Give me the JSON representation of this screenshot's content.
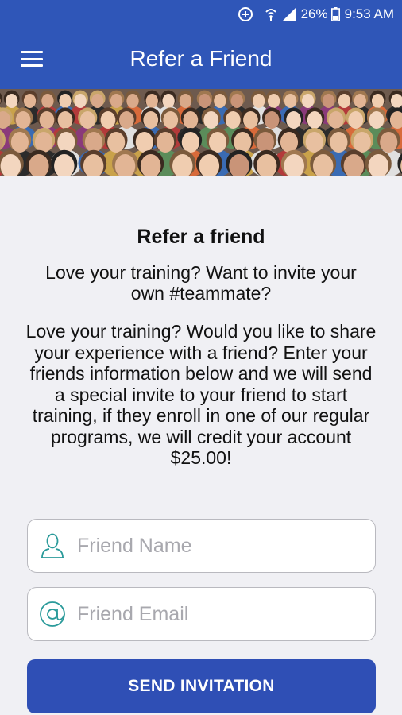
{
  "status_bar": {
    "battery": "26%",
    "time": "9:53 AM",
    "icons": [
      "data-saver-icon",
      "wifi-icon",
      "signal-icon",
      "battery-icon"
    ]
  },
  "app_bar": {
    "title": "Refer a Friend",
    "menu_icon": "hamburger-menu-icon"
  },
  "hero": {
    "image": "crowd-of-people-photo"
  },
  "main": {
    "heading": "Refer a friend",
    "subheading": "Love your training? Want to invite your own #teammate?",
    "description": "Love your training? Would you like to share your experience with a friend? Enter your friends information below and we will send a special invite to your friend to start training, if they enroll in one of our regular programs, we will credit your account $25.00!"
  },
  "form": {
    "name_placeholder": "Friend Name",
    "name_icon": "person-icon",
    "email_placeholder": "Friend Email",
    "email_icon": "at-sign-icon",
    "submit_label": "SEND INVITATION"
  },
  "colors": {
    "primary": "#2f56b8",
    "button": "#2f4fb5",
    "icon_teal": "#2a9a9a",
    "background": "#f0f0f4"
  }
}
